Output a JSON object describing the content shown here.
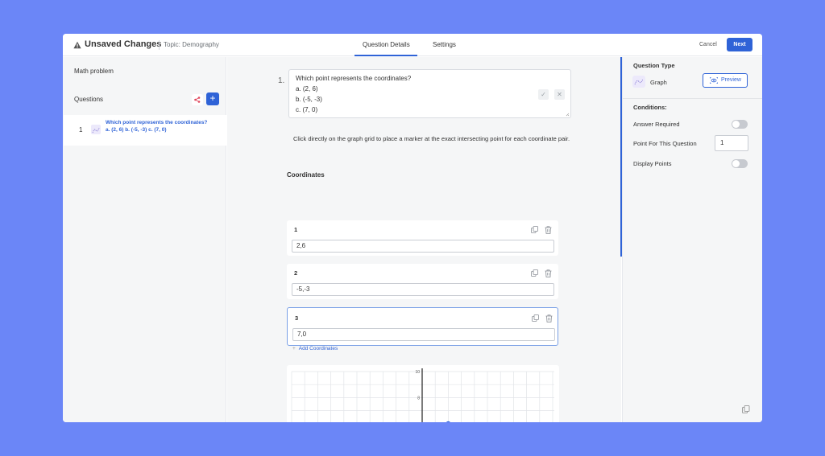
{
  "header": {
    "title": "Unsaved Changes",
    "topic": "Topic: Demography",
    "tabs": [
      "Question Details",
      "Settings"
    ],
    "cancel_label": "Cancel",
    "next_label": "Next"
  },
  "sidebar": {
    "section_title": "Math problem",
    "questions_label": "Questions",
    "add_symbol": "+",
    "items": [
      {
        "number": "1",
        "text": "Which point represents the coordinates? a. (2, 6) b. (-5, -3) c. (7, 0)"
      }
    ]
  },
  "question": {
    "number": "1.",
    "lines": [
      "Which point represents the coordinates?",
      "a. (2, 6)",
      "b. (-5, -3)",
      "c. (7, 0)"
    ],
    "instruction": "Click directly on the graph grid to place a marker at the exact intersecting point for each coordinate pair."
  },
  "coordinates": {
    "heading": "Coordinates",
    "items": [
      {
        "label": "1",
        "value": "2,6"
      },
      {
        "label": "2",
        "value": "-5,-3"
      },
      {
        "label": "3",
        "value": "7,0"
      }
    ],
    "add_label": "Add Coordinates",
    "add_symbol": "+"
  },
  "graph": {
    "y_tick_labels": [
      "10",
      "8",
      "6"
    ],
    "marker": {
      "x": 2,
      "y": 6
    },
    "accent": "#2f63d7"
  },
  "right_panel": {
    "question_type_label": "Question Type",
    "type_name": "Graph",
    "preview_label": "Preview",
    "conditions_label": "Conditions:",
    "answer_required_label": "Answer Required",
    "points_label": "Point For This Question",
    "points_value": "1",
    "display_points_label": "Display Points"
  }
}
